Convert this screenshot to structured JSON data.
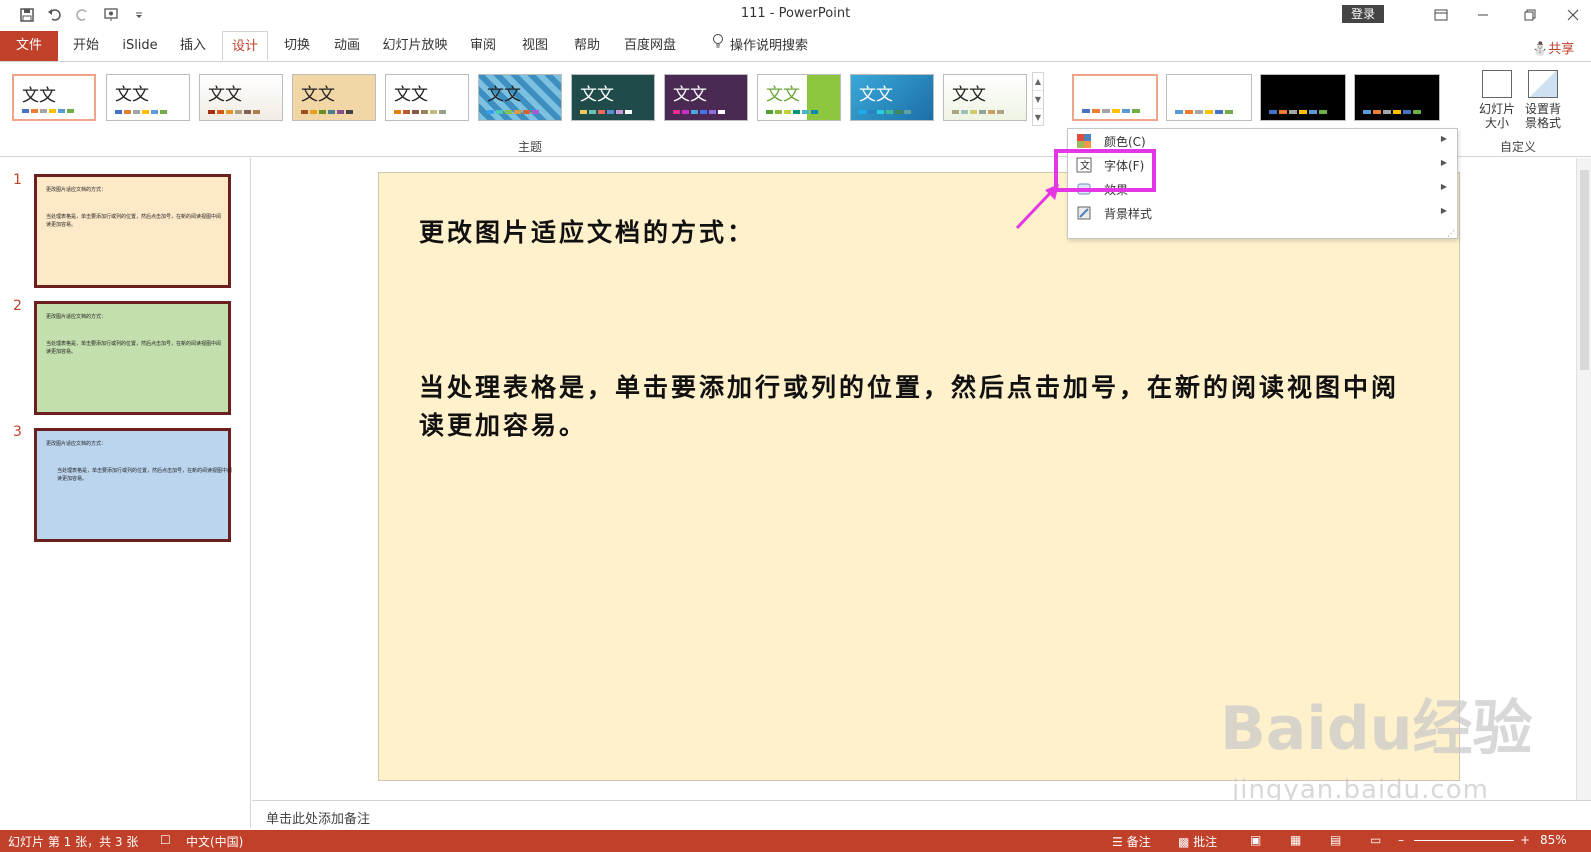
{
  "titlebar": {
    "title": "111  -  PowerPoint",
    "login_label": "登录",
    "qat_icons": [
      "save-icon",
      "undo-icon",
      "redo-icon",
      "present-icon",
      "customize-icon"
    ]
  },
  "tabs": [
    {
      "label": "文件"
    },
    {
      "label": "开始"
    },
    {
      "label": "iSlide"
    },
    {
      "label": "插入"
    },
    {
      "label": "设计"
    },
    {
      "label": "切换"
    },
    {
      "label": "动画"
    },
    {
      "label": "幻灯片放映"
    },
    {
      "label": "审阅"
    },
    {
      "label": "视图"
    },
    {
      "label": "帮助"
    },
    {
      "label": "百度网盘"
    },
    {
      "label": "操作说明搜索"
    }
  ],
  "share_label": "共享",
  "ribbon": {
    "themes_group_label": "主题",
    "theme_sample": "文文",
    "customize_group_label": "自定义",
    "slide_size_label": "幻灯片大小",
    "format_bg_label": "设置背景格式",
    "colors": {
      "accent": "#c1402a",
      "highlight": "#e536e5"
    }
  },
  "dropdown": {
    "items": [
      {
        "label": "颜色(C)",
        "icon": "color-palette-icon"
      },
      {
        "label": "字体(F)",
        "icon": "font-icon"
      },
      {
        "label": "效果",
        "icon": "effects-icon"
      },
      {
        "label": "背景样式",
        "icon": "background-style-icon"
      }
    ]
  },
  "thumbnails": [
    {
      "num": "1",
      "bg": "#fde9c8",
      "title": "更改图片适应文档的方式：",
      "body": "当处理表格是，单击要添加行或列的位置，然后点击加号，在新的阅读视图中阅读更加容易。"
    },
    {
      "num": "2",
      "bg": "#c4dfae",
      "title": "更改图片适应文档的方式：",
      "body": "当处理表格是，单击要添加行或列的位置，然后点击加号，在新的阅读视图中阅读更加容易。"
    },
    {
      "num": "3",
      "bg": "#bcd5ef",
      "title": "更改图片适应文档的方式：",
      "body": "当处理表格是，单击要添加行或列的位置，然后点击加号，在新的阅读视图中阅读更加容易。"
    }
  ],
  "slide": {
    "title": "更改图片适应文档的方式：",
    "body": "当处理表格是，单击要添加行或列的位置，然后点击加号，在新的阅读视图中阅读更加容易。"
  },
  "notes_placeholder": "单击此处添加备注",
  "statusbar": {
    "slide_info": "幻灯片 第 1 张，共 3 张",
    "language": "中文(中国)",
    "notes": "备注",
    "comments": "批注",
    "zoom": "85%"
  },
  "watermark": {
    "main": "Baidu经验",
    "sub": "jingyan.baidu.com"
  }
}
